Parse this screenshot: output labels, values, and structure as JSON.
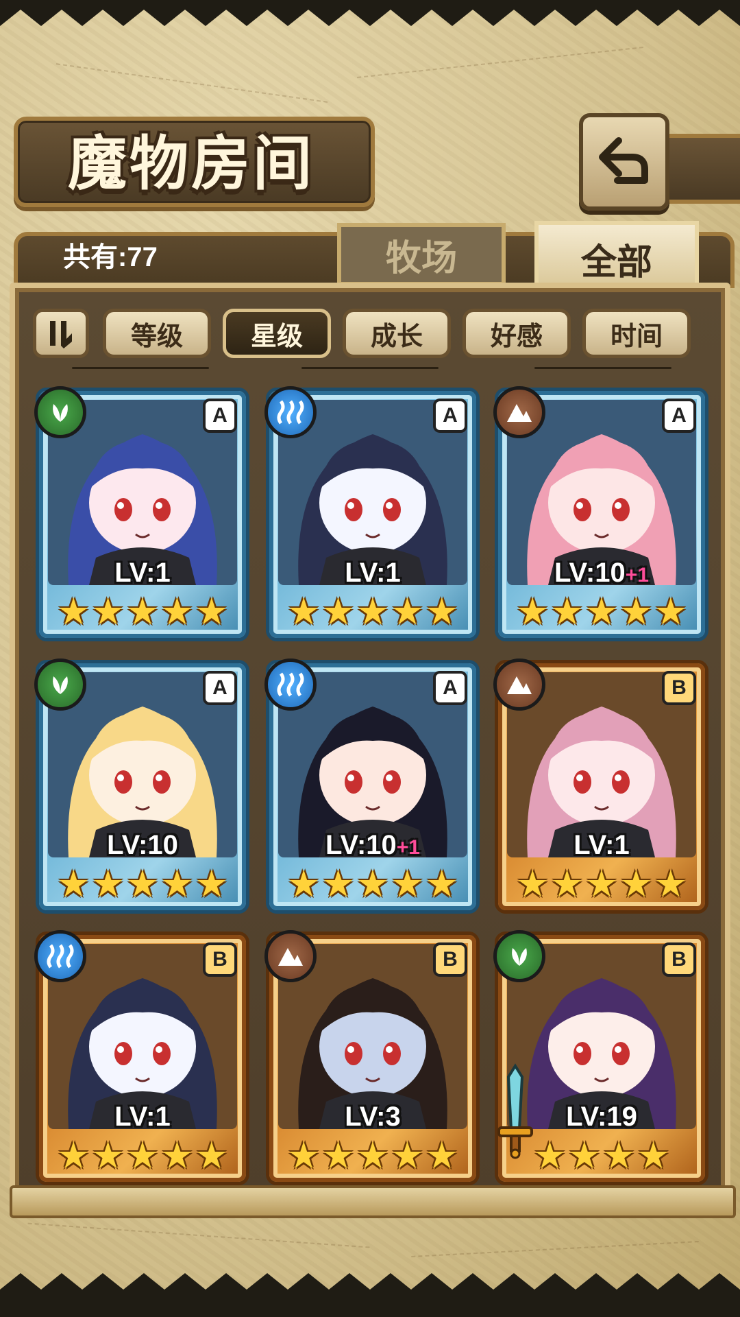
{
  "title": "魔物房间",
  "count_label": "共有:77",
  "tabs": [
    {
      "label": "牧场",
      "active": false
    },
    {
      "label": "全部",
      "active": true
    }
  ],
  "sort_buttons": [
    {
      "label": "等级",
      "active": false
    },
    {
      "label": "星级",
      "active": true
    },
    {
      "label": "成长",
      "active": false
    },
    {
      "label": "好感",
      "active": false
    },
    {
      "label": "时间",
      "active": false
    }
  ],
  "colors": {
    "rank_A_frame": "#6fb6d8",
    "rank_B_frame": "#d6862e",
    "leaf": "#49a84a",
    "water": "#52b0ff",
    "earth": "#a06848",
    "star": "#ffd23a",
    "plus": "#ff4d9a"
  },
  "monsters": [
    {
      "rank": "A",
      "element": "leaf-icon",
      "level": "LV:1",
      "bonus": "",
      "stars": 5,
      "hair": "#3a4ea8",
      "skin": "#fde8ee"
    },
    {
      "rank": "A",
      "element": "water-icon",
      "level": "LV:1",
      "bonus": "",
      "stars": 5,
      "hair": "#2a3050",
      "skin": "#f4f6ff"
    },
    {
      "rank": "A",
      "element": "earth-icon",
      "level": "LV:10",
      "bonus": "+1",
      "stars": 5,
      "hair": "#f0a0b4",
      "skin": "#fde6e6"
    },
    {
      "rank": "A",
      "element": "leaf-icon",
      "level": "LV:10",
      "bonus": "",
      "stars": 5,
      "hair": "#f8d888",
      "skin": "#fdf0e0"
    },
    {
      "rank": "A",
      "element": "water-icon",
      "level": "LV:10",
      "bonus": "+1",
      "stars": 5,
      "hair": "#1a1a2a",
      "skin": "#fde8e0"
    },
    {
      "rank": "B",
      "element": "earth-icon",
      "level": "LV:1",
      "bonus": "",
      "stars": 5,
      "hair": "#e2a0b8",
      "skin": "#fde8ea"
    },
    {
      "rank": "B",
      "element": "water-icon",
      "level": "LV:1",
      "bonus": "",
      "stars": 5,
      "hair": "#2a3050",
      "skin": "#f4f6ff"
    },
    {
      "rank": "B",
      "element": "earth-icon",
      "level": "LV:3",
      "bonus": "",
      "stars": 5,
      "hair": "#2a1e1a",
      "skin": "#c8d4ec"
    },
    {
      "rank": "B",
      "element": "leaf-icon",
      "level": "LV:19",
      "bonus": "",
      "stars": 4,
      "hair": "#4a2e6a",
      "skin": "#fdeeea"
    }
  ]
}
